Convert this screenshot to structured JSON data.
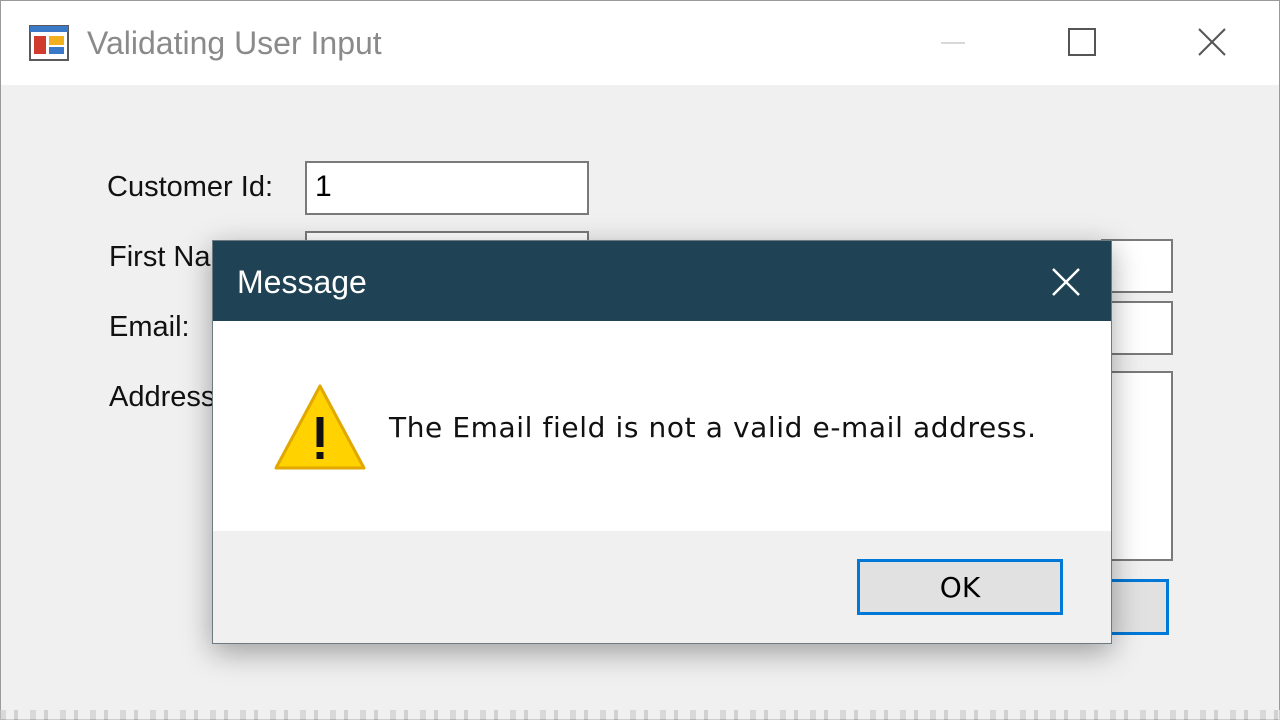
{
  "window": {
    "title": "Validating User Input",
    "icon": "windows-form-app-icon"
  },
  "form": {
    "labels": {
      "customer_id": "Customer Id:",
      "first_name": "First Na",
      "email": "Email:",
      "address": "Address"
    },
    "customer_id_value": "1"
  },
  "dialog": {
    "title": "Message",
    "message": "The Email field is not a valid e-mail address.",
    "icon": "warning-icon",
    "ok_label": "OK"
  },
  "colors": {
    "dialog_titlebar": "#1f4354",
    "focus_blue": "#0078d7",
    "warning_yellow": "#ffd200"
  }
}
